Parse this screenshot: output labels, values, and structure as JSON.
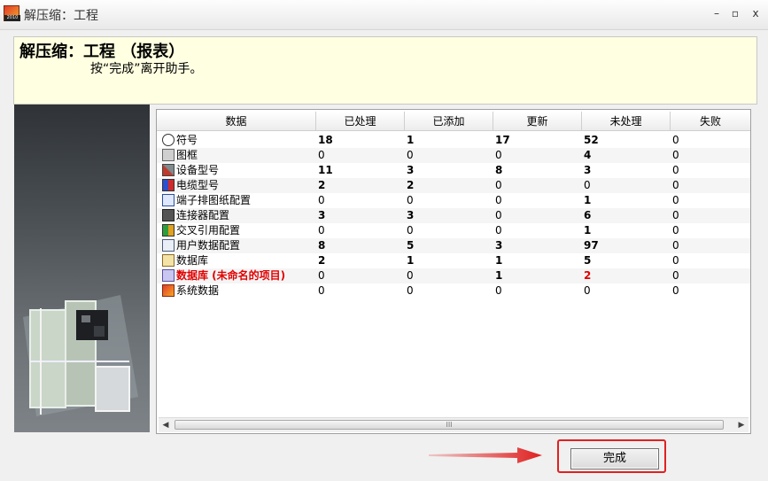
{
  "window": {
    "title": "解压缩：工程",
    "app_icon_label": "2010"
  },
  "window_controls": [
    "–",
    "▫",
    "x"
  ],
  "header": {
    "title": "解压缩：工程 （报表）",
    "subtitle": "按“完成”离开助手。"
  },
  "table": {
    "columns": [
      "数据",
      "已处理",
      "已添加",
      "更新",
      "未处理",
      "失败"
    ],
    "rows": [
      {
        "icon": "symbol-icon",
        "name": "符号",
        "processed": "18",
        "added": "1",
        "updated": "17",
        "unprocessed": "52",
        "failed": "0",
        "bold": [
          true,
          true,
          true,
          true,
          false
        ],
        "highlight": false
      },
      {
        "icon": "frame-icon",
        "name": "图框",
        "processed": "0",
        "added": "0",
        "updated": "0",
        "unprocessed": "4",
        "failed": "0",
        "bold": [
          false,
          false,
          false,
          true,
          false
        ],
        "highlight": false
      },
      {
        "icon": "device-type-icon",
        "name": "设备型号",
        "processed": "11",
        "added": "3",
        "updated": "8",
        "unprocessed": "3",
        "failed": "0",
        "bold": [
          true,
          true,
          true,
          true,
          false
        ],
        "highlight": false
      },
      {
        "icon": "cable-type-icon",
        "name": "电缆型号",
        "processed": "2",
        "added": "2",
        "updated": "0",
        "unprocessed": "0",
        "failed": "0",
        "bold": [
          true,
          true,
          false,
          false,
          false
        ],
        "highlight": false
      },
      {
        "icon": "terminal-config-icon",
        "name": "端子排图纸配置",
        "processed": "0",
        "added": "0",
        "updated": "0",
        "unprocessed": "1",
        "failed": "0",
        "bold": [
          false,
          false,
          false,
          true,
          false
        ],
        "highlight": false
      },
      {
        "icon": "connector-config-icon",
        "name": "连接器配置",
        "processed": "3",
        "added": "3",
        "updated": "0",
        "unprocessed": "6",
        "failed": "0",
        "bold": [
          true,
          true,
          false,
          true,
          false
        ],
        "highlight": false
      },
      {
        "icon": "cross-reference-icon",
        "name": "交叉引用配置",
        "processed": "0",
        "added": "0",
        "updated": "0",
        "unprocessed": "1",
        "failed": "0",
        "bold": [
          false,
          false,
          false,
          true,
          false
        ],
        "highlight": false
      },
      {
        "icon": "user-data-icon",
        "name": "用户数据配置",
        "processed": "8",
        "added": "5",
        "updated": "3",
        "unprocessed": "97",
        "failed": "0",
        "bold": [
          true,
          true,
          true,
          true,
          false
        ],
        "highlight": false
      },
      {
        "icon": "database-icon",
        "name": "数据库",
        "processed": "2",
        "added": "1",
        "updated": "1",
        "unprocessed": "5",
        "failed": "0",
        "bold": [
          true,
          true,
          true,
          true,
          false
        ],
        "highlight": false
      },
      {
        "icon": "database-unnamed-icon",
        "name": "数据库 (未命名的项目)",
        "processed": "0",
        "added": "0",
        "updated": "1",
        "unprocessed": "2",
        "failed": "0",
        "bold": [
          false,
          false,
          true,
          true,
          false
        ],
        "highlight": true
      },
      {
        "icon": "system-data-icon",
        "name": "系统数据",
        "processed": "0",
        "added": "0",
        "updated": "0",
        "unprocessed": "0",
        "failed": "0",
        "bold": [
          false,
          false,
          false,
          false,
          false
        ],
        "highlight": false
      }
    ]
  },
  "scrollbar": {
    "thumb_grip": "III"
  },
  "buttons": {
    "finish": "完成"
  }
}
